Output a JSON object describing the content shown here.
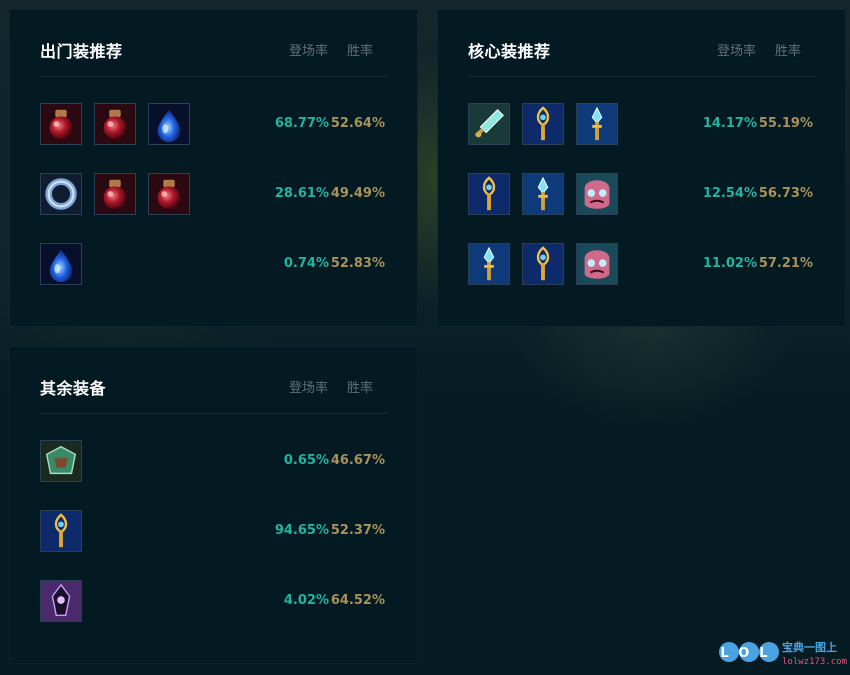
{
  "colors": {
    "pick_rate": "#22b3a2",
    "win_rate": "#a8915a",
    "panel_bg": "#041a22"
  },
  "starting_items": {
    "title": "出门装推荐",
    "col_pick": "登场率",
    "col_win": "胜率",
    "rows": [
      {
        "icons": [
          "red-potion-icon",
          "red-potion-icon",
          "blue-tear-icon"
        ],
        "pick": "68.77%",
        "win": "52.64%"
      },
      {
        "icons": [
          "ring-icon",
          "red-potion-icon",
          "red-potion-icon"
        ],
        "pick": "28.61%",
        "win": "49.49%"
      },
      {
        "icons": [
          "blue-tear-icon"
        ],
        "pick": "0.74%",
        "win": "52.83%"
      }
    ]
  },
  "core_items": {
    "title": "核心装推荐",
    "col_pick": "登场率",
    "col_win": "胜率",
    "rows": [
      {
        "icons": [
          "crystal-spear-icon",
          "golden-staff-icon",
          "crystal-staff-icon"
        ],
        "pick": "14.17%",
        "win": "55.19%"
      },
      {
        "icons": [
          "golden-staff-icon",
          "crystal-staff-icon",
          "ghost-mask-icon"
        ],
        "pick": "12.54%",
        "win": "56.73%"
      },
      {
        "icons": [
          "crystal-staff-icon",
          "golden-staff-icon",
          "ghost-mask-icon"
        ],
        "pick": "11.02%",
        "win": "57.21%"
      }
    ]
  },
  "other_items": {
    "title": "其余装备",
    "col_pick": "登场率",
    "col_win": "胜率",
    "rows": [
      {
        "icons": [
          "green-armor-icon"
        ],
        "pick": "0.65%",
        "win": "46.67%"
      },
      {
        "icons": [
          "golden-staff-icon"
        ],
        "pick": "94.65%",
        "win": "52.37%"
      },
      {
        "icons": [
          "purple-shard-icon"
        ],
        "pick": "4.02%",
        "win": "64.52%"
      }
    ]
  },
  "watermark": {
    "logo": "LOL",
    "brand": "宝典一图上",
    "url": "lolwz173.com"
  }
}
